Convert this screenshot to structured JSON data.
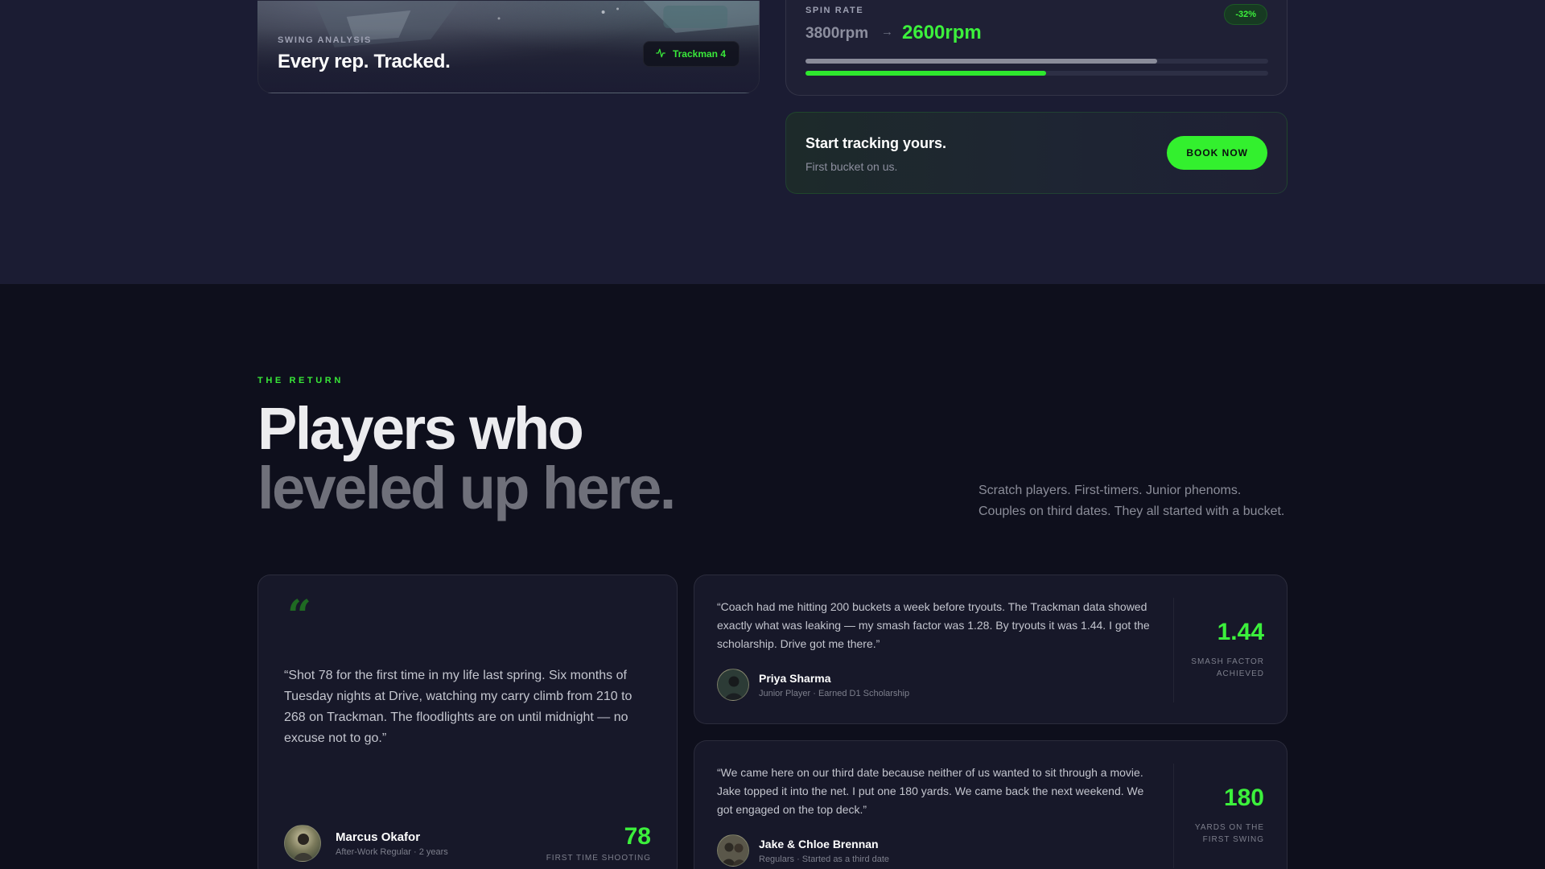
{
  "swing_card": {
    "eyebrow": "SWING ANALYSIS",
    "title": "Every rep. Tracked.",
    "badge": "Trackman 4",
    "badge_icon": "activity-icon"
  },
  "spin_card": {
    "label": "SPIN RATE",
    "before": "3800rpm",
    "after": "2600rpm",
    "change": "-32%",
    "before_bar_fraction": 0.76,
    "after_bar_fraction": 0.52,
    "arrow_icon": "arrow-right-icon"
  },
  "cta": {
    "title": "Start tracking yours.",
    "subtitle": "First bucket on us.",
    "button": "BOOK NOW"
  },
  "return_section": {
    "eyebrow": "THE RETURN",
    "headline_line1": "Players who",
    "headline_line2": "leveled up here.",
    "intro": "Scratch players. First-timers. Junior phenoms. Couples on third dates. They all started with a bucket."
  },
  "testimonials": [
    {
      "quote_mark": "“",
      "quote": "“Shot 78 for the first time in my life last spring. Six months of Tuesday nights at Drive, watching my carry climb from 210 to 268 on Trackman. The floodlights are on until midnight — no excuse not to go.”",
      "name": "Marcus Okafor",
      "role": "After-Work Regular · 2 years",
      "stat_value": "78",
      "stat_label": "FIRST TIME SHOOTING"
    },
    {
      "quote": "“Coach had me hitting 200 buckets a week before tryouts. The Trackman data showed exactly what was leaking — my smash factor was 1.28. By tryouts it was 1.44. I got the scholarship. Drive got me there.”",
      "name": "Priya Sharma",
      "role": "Junior Player · Earned D1 Scholarship",
      "stat_value": "1.44",
      "stat_label": "SMASH FACTOR ACHIEVED"
    },
    {
      "quote": "“We came here on our third date because neither of us wanted to sit through a movie. Jake topped it into the net. I put one 180 yards. We came back the next weekend. We got engaged on the top deck.”",
      "name": "Jake & Chloe Brennan",
      "role": "Regulars · Started as a third date",
      "stat_value": "180",
      "stat_label": "YARDS ON THE FIRST SWING"
    }
  ],
  "colors": {
    "accent": "#3cf03c",
    "section_top_bg": "#1b1c33",
    "page_bg": "#0e0f1c",
    "card_bg": "#171829"
  }
}
